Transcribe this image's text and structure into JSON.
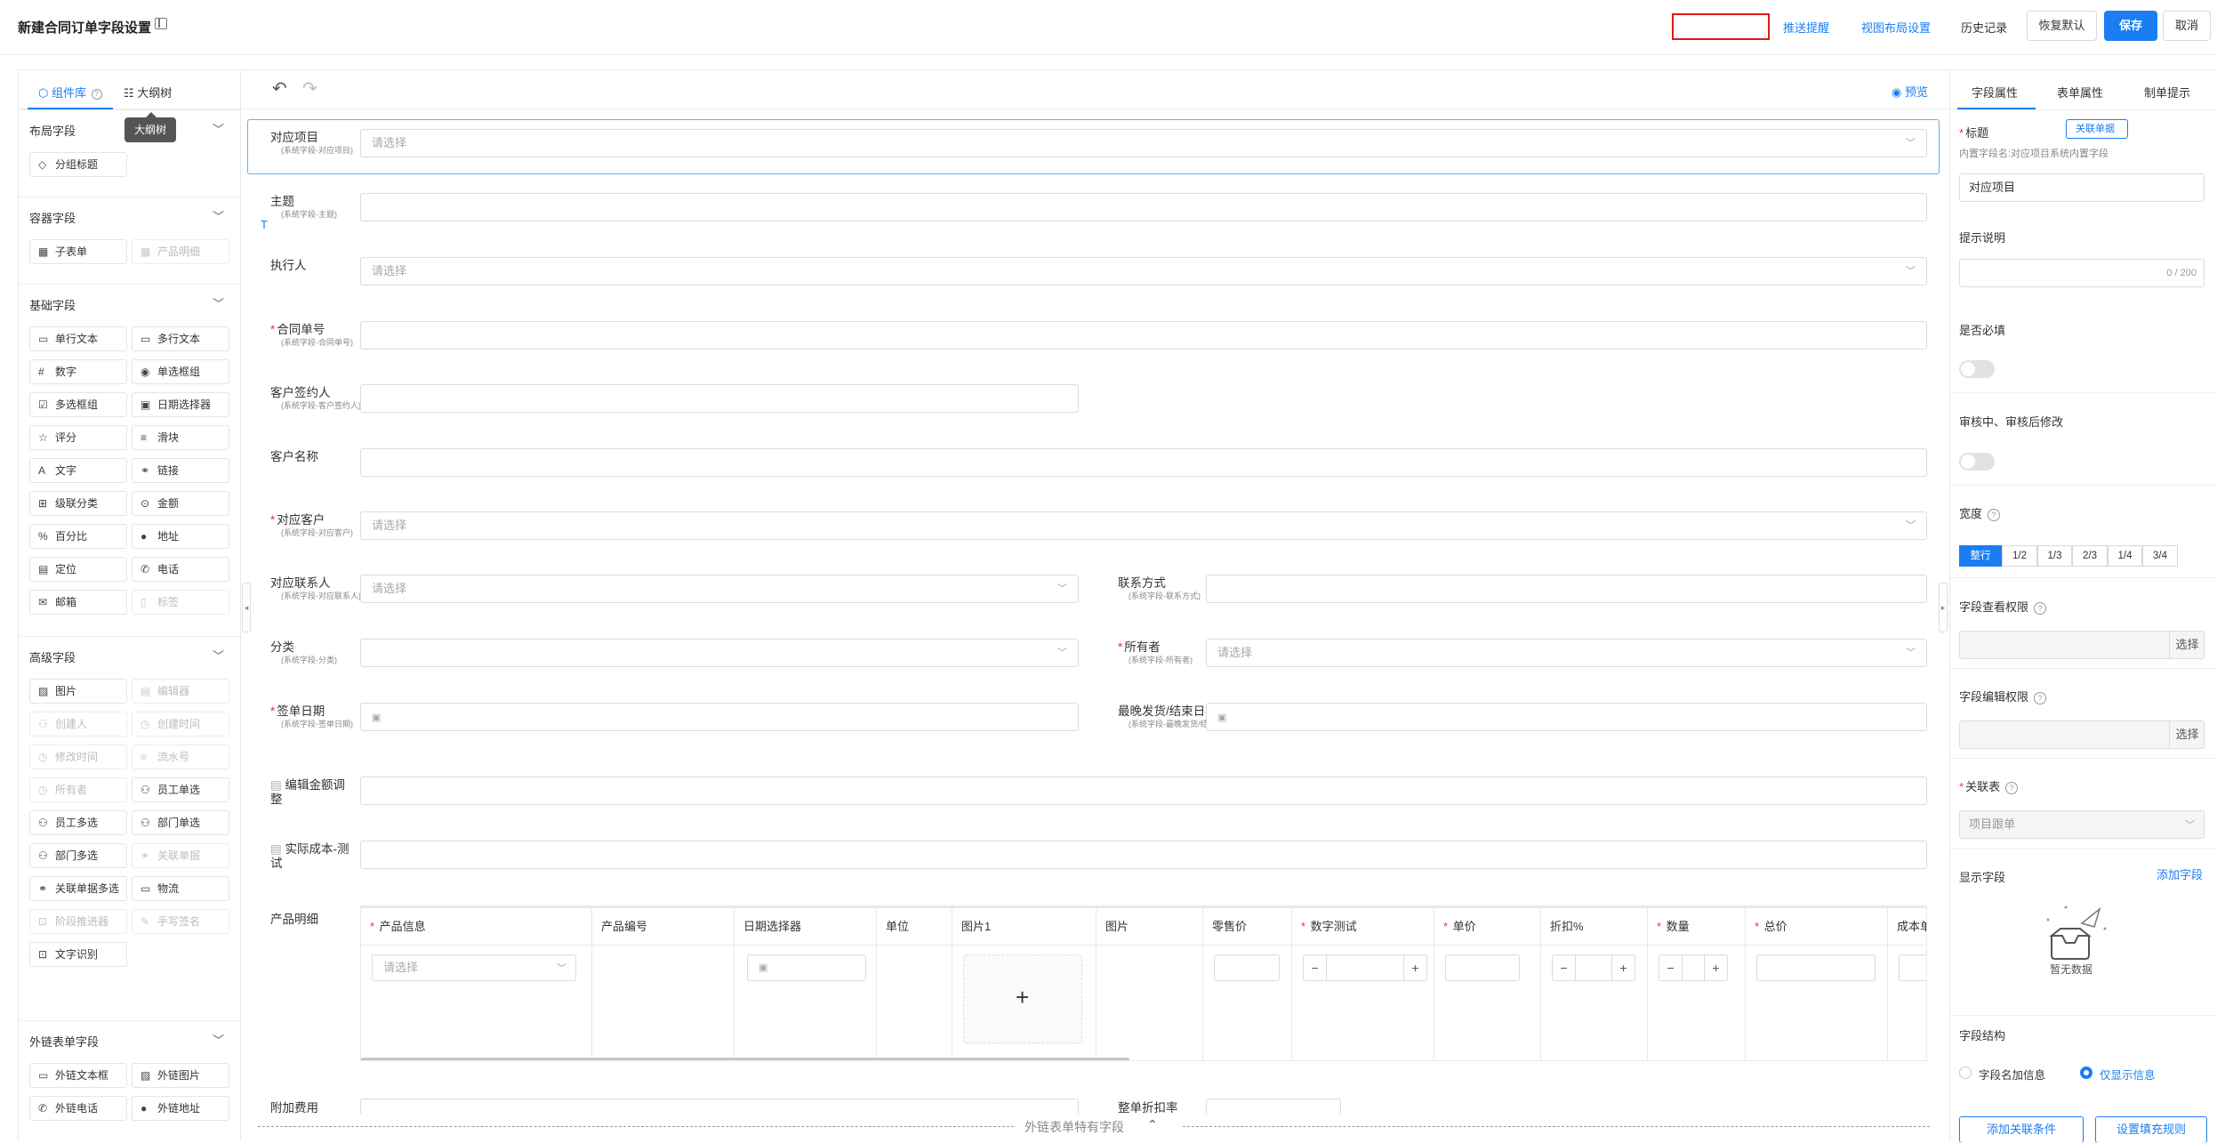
{
  "topbar": {
    "title": "新建合同订单字段设置",
    "links": [
      "推送提醒",
      "视图布局设置",
      "历史记录"
    ],
    "buttons": {
      "restore": "恢复默认",
      "save": "保存",
      "cancel": "取消"
    }
  },
  "left": {
    "tabs": [
      "组件库",
      "大纲树"
    ],
    "tooltip": "大纲树",
    "groups": [
      {
        "title": "布局字段",
        "items": [
          {
            "label": "分组标题",
            "icon": "◇",
            "disabled": false
          }
        ]
      },
      {
        "title": "容器字段",
        "items": [
          {
            "label": "子表单",
            "icon": "▦",
            "disabled": false
          },
          {
            "label": "产品明细",
            "icon": "▦",
            "disabled": true
          }
        ]
      },
      {
        "title": "基础字段",
        "items": [
          {
            "label": "单行文本",
            "icon": "▭",
            "disabled": false
          },
          {
            "label": "多行文本",
            "icon": "▭",
            "disabled": false
          },
          {
            "label": "数字",
            "icon": "#",
            "disabled": false
          },
          {
            "label": "单选框组",
            "icon": "◉",
            "disabled": false
          },
          {
            "label": "多选框组",
            "icon": "☑",
            "disabled": false
          },
          {
            "label": "日期选择器",
            "icon": "▣",
            "disabled": false
          },
          {
            "label": "评分",
            "icon": "☆",
            "disabled": false
          },
          {
            "label": "滑块",
            "icon": "≡",
            "disabled": false
          },
          {
            "label": "文字",
            "icon": "A",
            "disabled": false
          },
          {
            "label": "链接",
            "icon": "⚭",
            "disabled": false
          },
          {
            "label": "级联分类",
            "icon": "⊞",
            "disabled": false
          },
          {
            "label": "金额",
            "icon": "⊙",
            "disabled": false
          },
          {
            "label": "百分比",
            "icon": "%",
            "disabled": false
          },
          {
            "label": "地址",
            "icon": "●",
            "disabled": false
          },
          {
            "label": "定位",
            "icon": "▤",
            "disabled": false
          },
          {
            "label": "电话",
            "icon": "✆",
            "disabled": false
          },
          {
            "label": "邮箱",
            "icon": "✉",
            "disabled": false
          },
          {
            "label": "标签",
            "icon": "▯",
            "disabled": true
          }
        ]
      },
      {
        "title": "高级字段",
        "items": [
          {
            "label": "图片",
            "icon": "▨",
            "disabled": false
          },
          {
            "label": "编辑器",
            "icon": "▤",
            "disabled": true
          },
          {
            "label": "创建人",
            "icon": "⚇",
            "disabled": true
          },
          {
            "label": "创建时间",
            "icon": "◷",
            "disabled": true
          },
          {
            "label": "修改时间",
            "icon": "◷",
            "disabled": true
          },
          {
            "label": "流水号",
            "icon": "≡",
            "disabled": true
          },
          {
            "label": "所有者",
            "icon": "◷",
            "disabled": true
          },
          {
            "label": "员工单选",
            "icon": "⚇",
            "disabled": false
          },
          {
            "label": "员工多选",
            "icon": "⚇",
            "disabled": false
          },
          {
            "label": "部门单选",
            "icon": "⚇",
            "disabled": false
          },
          {
            "label": "部门多选",
            "icon": "⚇",
            "disabled": false
          },
          {
            "label": "关联单据",
            "icon": "⚭",
            "disabled": true
          },
          {
            "label": "关联单据多选",
            "icon": "⚭",
            "disabled": false
          },
          {
            "label": "物流",
            "icon": "▭",
            "disabled": false
          },
          {
            "label": "阶段推进器",
            "icon": "⊡",
            "disabled": true
          },
          {
            "label": "手写签名",
            "icon": "✎",
            "disabled": true
          },
          {
            "label": "文字识别",
            "icon": "⊡",
            "disabled": false
          }
        ]
      },
      {
        "title": "外链表单字段",
        "items": [
          {
            "label": "外链文本框",
            "icon": "▭",
            "disabled": false
          },
          {
            "label": "外链图片",
            "icon": "▨",
            "disabled": false
          },
          {
            "label": "外链电话",
            "icon": "✆",
            "disabled": false
          },
          {
            "label": "外链地址",
            "icon": "●",
            "disabled": false
          }
        ]
      }
    ]
  },
  "center": {
    "preview": "预览",
    "placeholder": "请选择",
    "fields": [
      {
        "label": "对应项目",
        "sub": "(系统字段-对应项目)",
        "req": false,
        "type": "select"
      },
      {
        "label": "主题",
        "sub": "(系统字段-主题)",
        "req": false,
        "type": "input"
      },
      {
        "label": "执行人",
        "sub": "",
        "req": false,
        "type": "select"
      },
      {
        "label": "合同单号",
        "sub": "(系统字段-合同单号)",
        "req": true,
        "type": "input"
      },
      {
        "label": "客户签约人",
        "sub": "(系统字段-客户签约人)",
        "req": false,
        "type": "input-half"
      },
      {
        "label": "客户名称",
        "sub": "",
        "req": false,
        "type": "input"
      },
      {
        "label": "对应客户",
        "sub": "(系统字段-对应客户)",
        "req": true,
        "type": "select"
      }
    ],
    "pairs": [
      {
        "left": {
          "label": "对应联系人",
          "sub": "(系统字段-对应联系人)",
          "req": false,
          "ph": "请选择"
        },
        "right": {
          "label": "联系方式",
          "sub": "(系统字段-联系方式)",
          "req": false,
          "ph": ""
        }
      },
      {
        "left": {
          "label": "分类",
          "sub": "(系统字段-分类)",
          "req": false,
          "ph": ""
        },
        "right": {
          "label": "所有者",
          "sub": "(系统字段-所有者)",
          "req": true,
          "ph": "请选择"
        }
      },
      {
        "left": {
          "label": "签单日期",
          "sub": "(系统字段-签单日期)",
          "req": true,
          "ph": ""
        },
        "right": {
          "label": "最晚发货/结束日期",
          "sub": "(系统字段-最晚发货/结束日期)",
          "req": false,
          "ph": ""
        }
      }
    ],
    "extra": [
      {
        "label": "编辑金额调整"
      },
      {
        "label": "实际成本-测试"
      }
    ],
    "product_label": "产品明细",
    "table_headers": [
      {
        "t": "产品信息",
        "req": true
      },
      {
        "t": "产品编号",
        "req": false
      },
      {
        "t": "日期选择器",
        "req": false
      },
      {
        "t": "单位",
        "req": false
      },
      {
        "t": "图片1",
        "req": false
      },
      {
        "t": "图片",
        "req": false
      },
      {
        "t": "零售价",
        "req": false
      },
      {
        "t": "数字测试",
        "req": true
      },
      {
        "t": "单价",
        "req": true
      },
      {
        "t": "折扣%",
        "req": false
      },
      {
        "t": "数量",
        "req": true
      },
      {
        "t": "总价",
        "req": true
      },
      {
        "t": "成本单",
        "req": false
      }
    ],
    "bottom_left": "附加费用",
    "bottom_right": "整单折扣率",
    "footer": "外链表单特有字段"
  },
  "right": {
    "tabs": [
      "字段属性",
      "表单属性",
      "制单提示"
    ],
    "title_label": "标题",
    "link_btn": "关联单据",
    "hint": "内置字段名:对应项目系统内置字段",
    "title_value": "对应项目",
    "desc_label": "提示说明",
    "counter": "0 / 200",
    "required_label": "是否必填",
    "audit_label": "审核中、审核后修改",
    "width_label": "宽度",
    "widths": [
      "整行",
      "1/2",
      "1/3",
      "2/3",
      "1/4",
      "3/4"
    ],
    "view_perm": "字段查看权限",
    "edit_perm": "字段编辑权限",
    "choose": "选择",
    "link_table": "关联表",
    "link_table_value": "项目跟单",
    "display_label": "显示字段",
    "add_field": "添加字段",
    "empty": "暂无数据",
    "structure": "字段结构",
    "radio1": "字段名加信息",
    "radio2": "仅显示信息",
    "btn1": "添加关联条件",
    "btn2": "设置填充规则"
  },
  "colors": {
    "accent": "#1a7ef2",
    "required": "#e5343f"
  }
}
